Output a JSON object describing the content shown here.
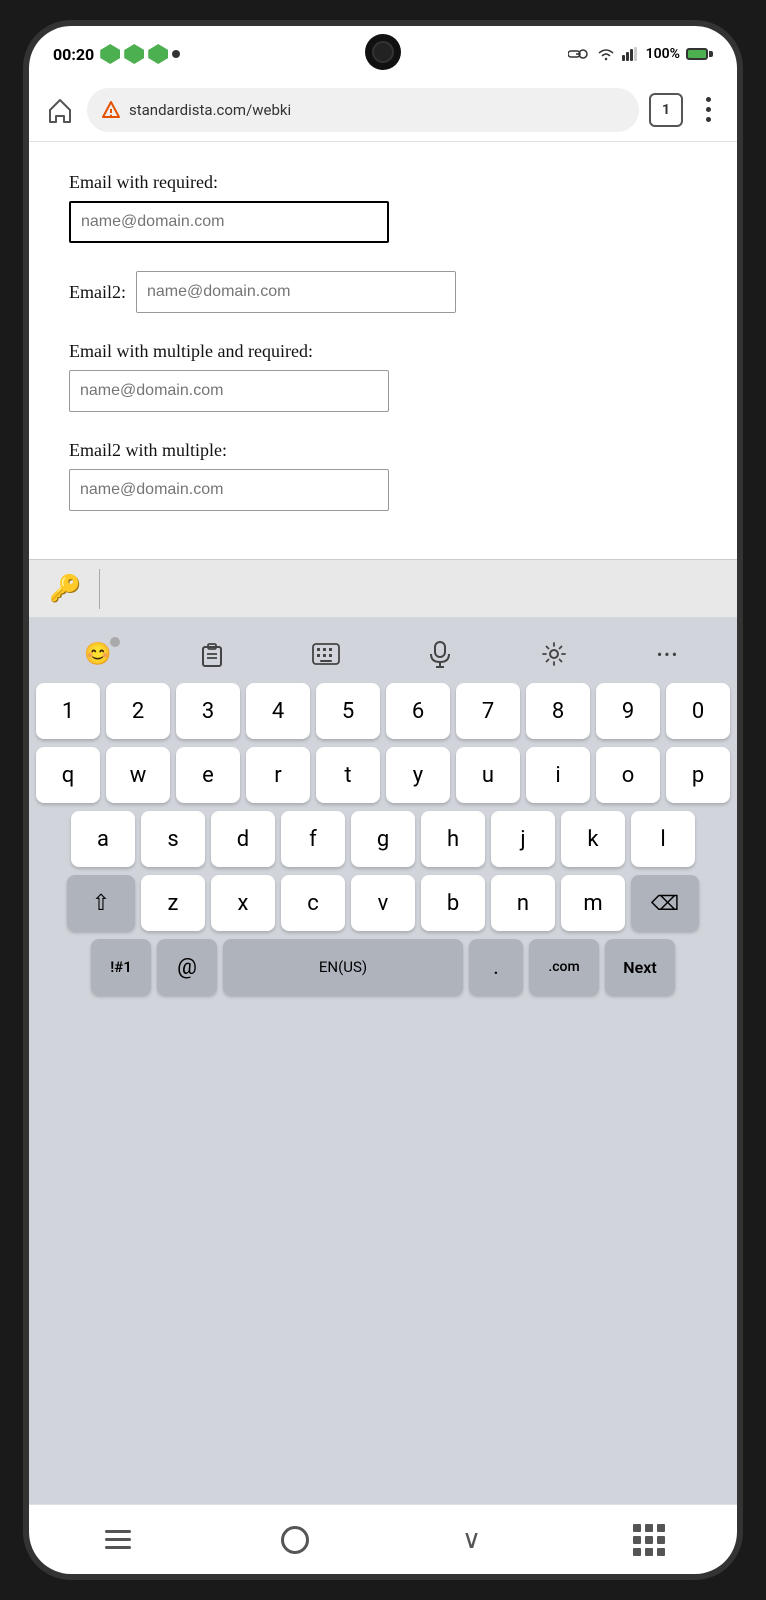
{
  "status_bar": {
    "time": "00:20",
    "dot": "•",
    "battery": "100%",
    "tab_count": "1"
  },
  "browser": {
    "address": "standardista.com/webki",
    "tab_count": "1"
  },
  "form": {
    "field1_label": "Email with required:",
    "field1_placeholder": "name@domain.com",
    "field2_label": "Email2:",
    "field2_placeholder": "name@domain.com",
    "field3_label": "Email with multiple and required:",
    "field3_placeholder": "name@domain.com",
    "field4_label": "Email2 with multiple:",
    "field4_placeholder": "name@domain.com"
  },
  "keyboard": {
    "toolbar_buttons": [
      "😊",
      "📋",
      "⌨",
      "🎤",
      "⚙",
      "•••"
    ],
    "row1": [
      "1",
      "2",
      "3",
      "4",
      "5",
      "6",
      "7",
      "8",
      "9",
      "0"
    ],
    "row2": [
      "q",
      "w",
      "e",
      "r",
      "t",
      "y",
      "u",
      "i",
      "o",
      "p"
    ],
    "row3": [
      "a",
      "s",
      "d",
      "f",
      "g",
      "h",
      "j",
      "k",
      "l"
    ],
    "row4": [
      "z",
      "x",
      "c",
      "v",
      "b",
      "n",
      "m"
    ],
    "bottom_row": [
      "!#1",
      "@",
      "EN(US)",
      ".",
      "com",
      "Next"
    ],
    "shift_symbol": "⇧",
    "delete_symbol": "⌫"
  },
  "bottom_nav": {
    "items": [
      "menu",
      "home",
      "back",
      "keyboard"
    ]
  }
}
